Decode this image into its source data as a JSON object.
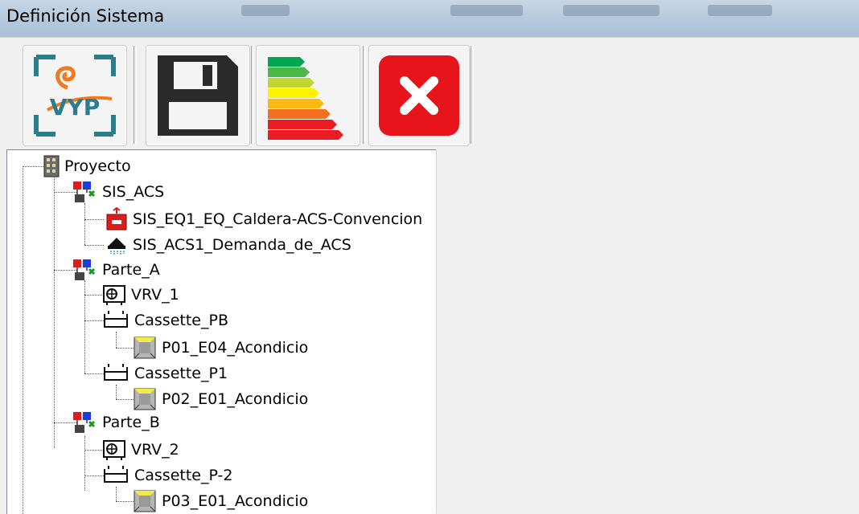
{
  "window": {
    "title": "Definición Sistema"
  },
  "toolbar": {
    "buttons": [
      {
        "name": "logo-button",
        "text": "VYP",
        "icon": "vyp-logo-icon"
      },
      {
        "name": "save-button",
        "icon": "floppy-disk-icon"
      },
      {
        "name": "energy-rating-button",
        "icon": "energy-rating-icon"
      },
      {
        "name": "close-button",
        "icon": "close-x-icon"
      }
    ]
  },
  "colors": {
    "close_red": "#e8141c",
    "title_bar": "#b9cbdf",
    "logo_teal": "#2b7c8c",
    "logo_orange": "#f07b1e"
  },
  "tree": {
    "root": "Proyecto",
    "sis_acs": "SIS_ACS",
    "sis_eq1": "SIS_EQ1_EQ_Caldera-ACS-Convencion",
    "sis_acs1": "SIS_ACS1_Demanda_de_ACS",
    "parte_a": "Parte_A",
    "vrv_1": "VRV_1",
    "cassette_pb": "Cassette_PB",
    "p01": "P01_E04_Acondicio",
    "cassette_p1": "Cassette_P1",
    "p02": "P02_E01_Acondicio",
    "parte_b": "Parte_B",
    "vrv_2": "VRV_2",
    "cassette_p2": "Cassette_P-2",
    "p03": "P03_E01_Acondicio"
  }
}
